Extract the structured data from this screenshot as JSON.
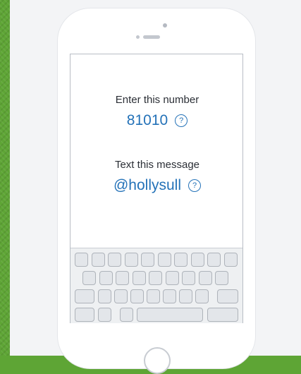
{
  "instructions": {
    "number_label": "Enter this number",
    "number_value": "81010",
    "message_label": "Text this message",
    "message_value": "@hollysull",
    "help_glyph": "?"
  },
  "icons": [
    "help-icon",
    "camera-icon",
    "speaker-icon",
    "home-button-icon"
  ],
  "colors": {
    "accent": "#2472b8",
    "background": "#5ea535",
    "card": "#f3f4f6"
  }
}
